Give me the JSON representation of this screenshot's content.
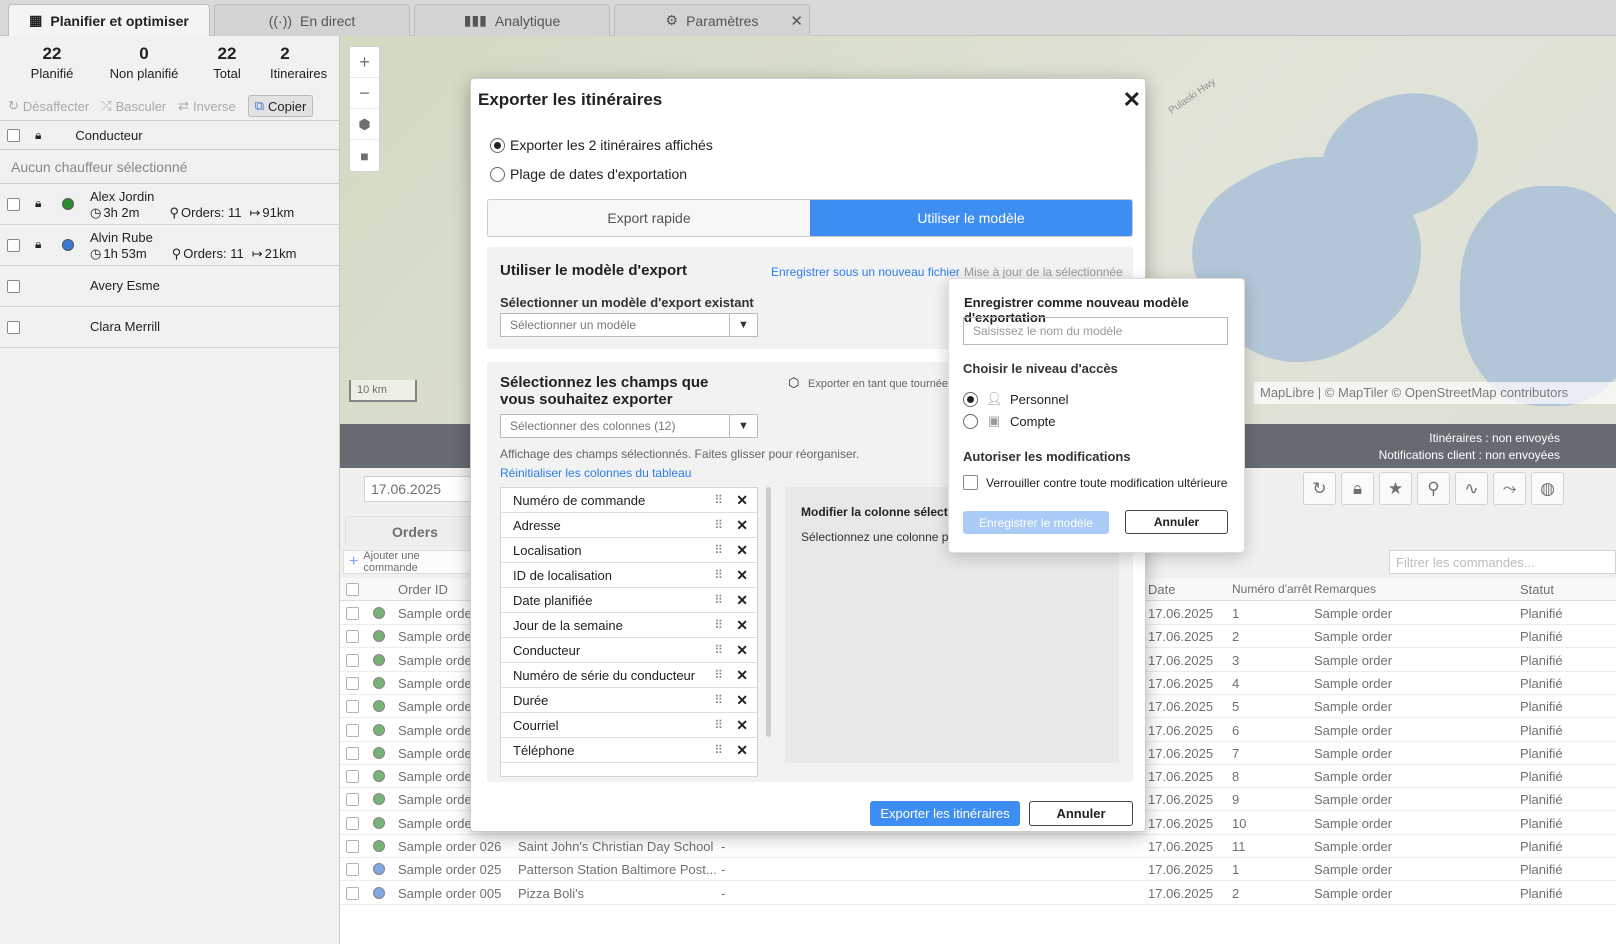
{
  "tabs": [
    {
      "label": "Planifier et optimiser",
      "icon": "calendar-icon",
      "active": true
    },
    {
      "label": "En direct",
      "icon": "broadcast-icon"
    },
    {
      "label": "Analytique",
      "icon": "bar-chart-icon"
    },
    {
      "label": "Paramètres",
      "icon": "gear-icon",
      "close": "✕"
    }
  ],
  "stats": [
    {
      "value": "22",
      "label": "Planifié"
    },
    {
      "value": "0",
      "label": "Non planifié"
    },
    {
      "value": "22",
      "label": "Total"
    },
    {
      "value": "2",
      "label": "Itineraires"
    }
  ],
  "actions": {
    "unassign": "Désaffecter",
    "toggle": "Basculer",
    "reverse": "Inverse",
    "copy": "Copier"
  },
  "driver_header": "Conducteur",
  "no_driver": "Aucun chauffeur sélectionné",
  "drivers": [
    {
      "name": "Alex Jordin",
      "time": "3h 2m",
      "orders": "Orders: 11",
      "distance": "91km",
      "color": "#2e8b2e"
    },
    {
      "name": "Alvin Rube",
      "time": "1h 53m",
      "orders": "Orders: 11",
      "distance": "21km",
      "color": "#3a7bd5"
    },
    {
      "name": "Avery Esme"
    },
    {
      "name": "Clara Merrill"
    }
  ],
  "map": {
    "scale": "10 km",
    "attribution": "MapLibre | © MapTiler © OpenStreetMap contributors",
    "road_label": "Pulaski Hwy"
  },
  "status_bar": {
    "routes": "Itinéraires : non envoyés",
    "notifications": "Notifications client : non envoyées"
  },
  "date": "17.06.2025",
  "orders_tab": "Orders",
  "add_order": "Ajouter une commande",
  "filter_placeholder": "Filtrer les commandes...",
  "table": {
    "headers": {
      "id": "Order ID",
      "date": "Date",
      "stop": "Numéro d'arrêt",
      "remarks": "Remarques",
      "status": "Statut"
    },
    "rows": [
      {
        "id": "Sample orde",
        "loc": "",
        "dash": "",
        "date": "17.06.2025",
        "stop": "1",
        "remarks": "Sample order",
        "status": "Planifié",
        "color": "#2e8b2e"
      },
      {
        "id": "Sample orde",
        "loc": "",
        "dash": "",
        "date": "17.06.2025",
        "stop": "2",
        "remarks": "Sample order",
        "status": "Planifié",
        "color": "#2e8b2e"
      },
      {
        "id": "Sample orde",
        "loc": "",
        "dash": "",
        "date": "17.06.2025",
        "stop": "3",
        "remarks": "Sample order",
        "status": "Planifié",
        "color": "#2e8b2e"
      },
      {
        "id": "Sample orde",
        "loc": "",
        "dash": "",
        "date": "17.06.2025",
        "stop": "4",
        "remarks": "Sample order",
        "status": "Planifié",
        "color": "#2e8b2e"
      },
      {
        "id": "Sample orde",
        "loc": "",
        "dash": "",
        "date": "17.06.2025",
        "stop": "5",
        "remarks": "Sample order",
        "status": "Planifié",
        "color": "#2e8b2e"
      },
      {
        "id": "Sample orde",
        "loc": "",
        "dash": "",
        "date": "17.06.2025",
        "stop": "6",
        "remarks": "Sample order",
        "status": "Planifié",
        "color": "#2e8b2e"
      },
      {
        "id": "Sample orde",
        "loc": "",
        "dash": "",
        "date": "17.06.2025",
        "stop": "7",
        "remarks": "Sample order",
        "status": "Planifié",
        "color": "#2e8b2e"
      },
      {
        "id": "Sample orde",
        "loc": "",
        "dash": "",
        "date": "17.06.2025",
        "stop": "8",
        "remarks": "Sample order",
        "status": "Planifié",
        "color": "#2e8b2e"
      },
      {
        "id": "Sample orde",
        "loc": "",
        "dash": "",
        "date": "17.06.2025",
        "stop": "9",
        "remarks": "Sample order",
        "status": "Planifié",
        "color": "#2e8b2e"
      },
      {
        "id": "Sample orde",
        "loc": "",
        "dash": "",
        "date": "17.06.2025",
        "stop": "10",
        "remarks": "Sample order",
        "status": "Planifié",
        "color": "#2e8b2e"
      },
      {
        "id": "Sample order 026",
        "loc": "Saint John's Christian Day School",
        "dash": "-",
        "date": "17.06.2025",
        "stop": "11",
        "remarks": "Sample order",
        "status": "Planifié",
        "color": "#2e8b2e"
      },
      {
        "id": "Sample order 025",
        "loc": "Patterson Station Baltimore Post...",
        "dash": "-",
        "date": "17.06.2025",
        "stop": "1",
        "remarks": "Sample order",
        "status": "Planifié",
        "color": "#3a7bd5"
      },
      {
        "id": "Sample order 005",
        "loc": "Pizza Boli's",
        "dash": "-",
        "date": "17.06.2025",
        "stop": "2",
        "remarks": "Sample order",
        "status": "Planifié",
        "color": "#3a7bd5"
      }
    ]
  },
  "modal": {
    "title": "Exporter les itinéraires",
    "close": "✕",
    "option1": "Exporter les 2 itinéraires affichés",
    "option2": "Plage de dates d'exportation",
    "seg_quick": "Export rapide",
    "seg_template": "Utiliser le modèle",
    "template_title": "Utiliser le modèle d'export",
    "save_new_link": "Enregistrer sous un nouveau fichier",
    "update_selected": "Mise à jour de la sélectionnée",
    "select_existing_label": "Sélectionner un modèle d'export existant",
    "select_template_placeholder": "Sélectionner un modèle",
    "fields_title": "Sélectionnez les champs que vous souhaitez exporter",
    "export_as_route": "Exporter en tant que tournée",
    "select_columns": "Sélectionner des colonnes (12)",
    "hint": "Affichage des champs sélectionnés. Faites glisser pour réorganiser.",
    "reset_link": "Réinitialiser les colonnes du tableau",
    "fields": [
      "Numéro de commande",
      "Adresse",
      "Localisation",
      "ID de localisation",
      "Date planifiée",
      "Jour de la semaine",
      "Conducteur",
      "Numéro de série du conducteur",
      "Durée",
      "Courriel",
      "Téléphone"
    ],
    "edit_col_title": "Modifier la colonne sélectionnée",
    "edit_col_hint": "Sélectionnez une colonne pour",
    "export_btn": "Exporter les itinéraires",
    "cancel_btn": "Annuler"
  },
  "popover": {
    "title": "Enregistrer comme nouveau modèle d'exportation",
    "name_placeholder": "Saisissez le nom du modèle",
    "access_title": "Choisir le niveau d'accès",
    "personal": "Personnel",
    "account": "Compte",
    "allow_title": "Autoriser les modifications",
    "lock_label": "Verrouiller contre toute modification ultérieure",
    "save_btn": "Enregistrer le modèle",
    "cancel_btn": "Annuler"
  },
  "colors": {
    "accent": "#3d8ef0",
    "dark": "#141b26"
  }
}
